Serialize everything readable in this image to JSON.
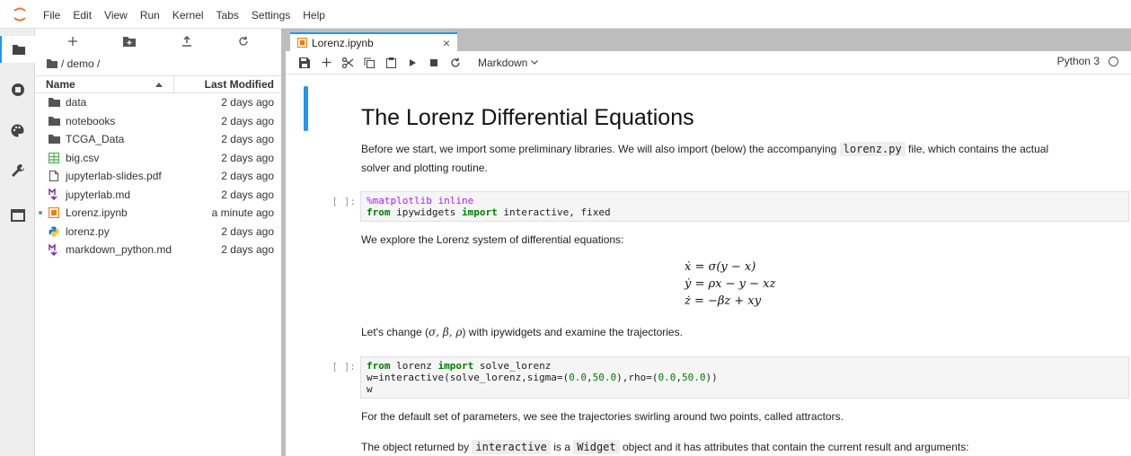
{
  "menu": {
    "items": [
      "File",
      "Edit",
      "View",
      "Run",
      "Kernel",
      "Tabs",
      "Settings",
      "Help"
    ]
  },
  "activity_bar": {
    "icons": [
      "folder-icon",
      "running-icon",
      "palette-icon",
      "wrench-icon",
      "tabs-icon"
    ]
  },
  "file_browser": {
    "breadcrumb": "/ demo /",
    "columns": {
      "name": "Name",
      "modified": "Last Modified"
    },
    "files": [
      {
        "name": "data",
        "modified": "2 days ago",
        "icon": "folder-icon",
        "running": false
      },
      {
        "name": "notebooks",
        "modified": "2 days ago",
        "icon": "folder-icon",
        "running": false
      },
      {
        "name": "TCGA_Data",
        "modified": "2 days ago",
        "icon": "folder-icon",
        "running": false
      },
      {
        "name": "big.csv",
        "modified": "2 days ago",
        "icon": "spreadsheet-icon",
        "running": false
      },
      {
        "name": "jupyterlab-slides.pdf",
        "modified": "2 days ago",
        "icon": "file-icon",
        "running": false
      },
      {
        "name": "jupyterlab.md",
        "modified": "2 days ago",
        "icon": "markdown-icon",
        "running": false
      },
      {
        "name": "Lorenz.ipynb",
        "modified": "a minute ago",
        "icon": "notebook-icon",
        "running": true
      },
      {
        "name": "lorenz.py",
        "modified": "2 days ago",
        "icon": "python-icon",
        "running": false
      },
      {
        "name": "markdown_python.md",
        "modified": "2 days ago",
        "icon": "markdown-icon",
        "running": false
      }
    ]
  },
  "tab": {
    "label": "Lorenz.ipynb",
    "close": "×"
  },
  "notebook_toolbar": {
    "cell_type": "Markdown",
    "kernel": "Python 3"
  },
  "notebook": {
    "title": "The Lorenz Differential Equations",
    "intro_before": "Before we start, we import some preliminary libraries. We will also import (below) the accompanying",
    "intro_code": "lorenz.py",
    "intro_after": "file, which contains the actual",
    "intro_line2": "solver and plotting routine.",
    "prompt": "[ ]:",
    "cell1": {
      "line1": "%matplotlib inline",
      "line2_kw1": "from",
      "line2_mod": " ipywidgets ",
      "line2_kw2": "import",
      "line2_rest": " interactive, fixed"
    },
    "explore": "We explore the Lorenz system of differential equations:",
    "equations": [
      "ẋ = σ(y − x)",
      "ẏ = ρx − y − xz",
      "ż = −βz + xy"
    ],
    "change_before": "Let's change (",
    "change_greek": "σ, β, ρ",
    "change_after": ") with ipywidgets and examine the trajectories.",
    "cell2": {
      "l1_kw1": "from",
      "l1_mod": " lorenz ",
      "l1_kw2": "import",
      "l1_rest": " solve_lorenz",
      "l2_a": "w=interactive(solve_lorenz,sigma=(",
      "l2_n1": "0.0",
      "l2_c1": ",",
      "l2_n2": "50.0",
      "l2_b": "),rho=(",
      "l2_n3": "0.0",
      "l2_c2": ",",
      "l2_n4": "50.0",
      "l2_end": "))",
      "l3": "w"
    },
    "default_text": "For the default set of parameters, we see the trajectories swirling around two points, called attractors.",
    "returned_before": "The object returned by",
    "returned_code1": "interactive",
    "returned_mid": "is a",
    "returned_code2": "Widget",
    "returned_after": "object and it has attributes that contain the current result and arguments:"
  },
  "colors": {
    "accent": "#2196f3",
    "notebook_icon": "#f57c00",
    "csv_icon": "#4caf50",
    "markdown_icon": "#7b1fa2",
    "python_icon": "#1976d2",
    "running_dot": "#4caf50"
  }
}
